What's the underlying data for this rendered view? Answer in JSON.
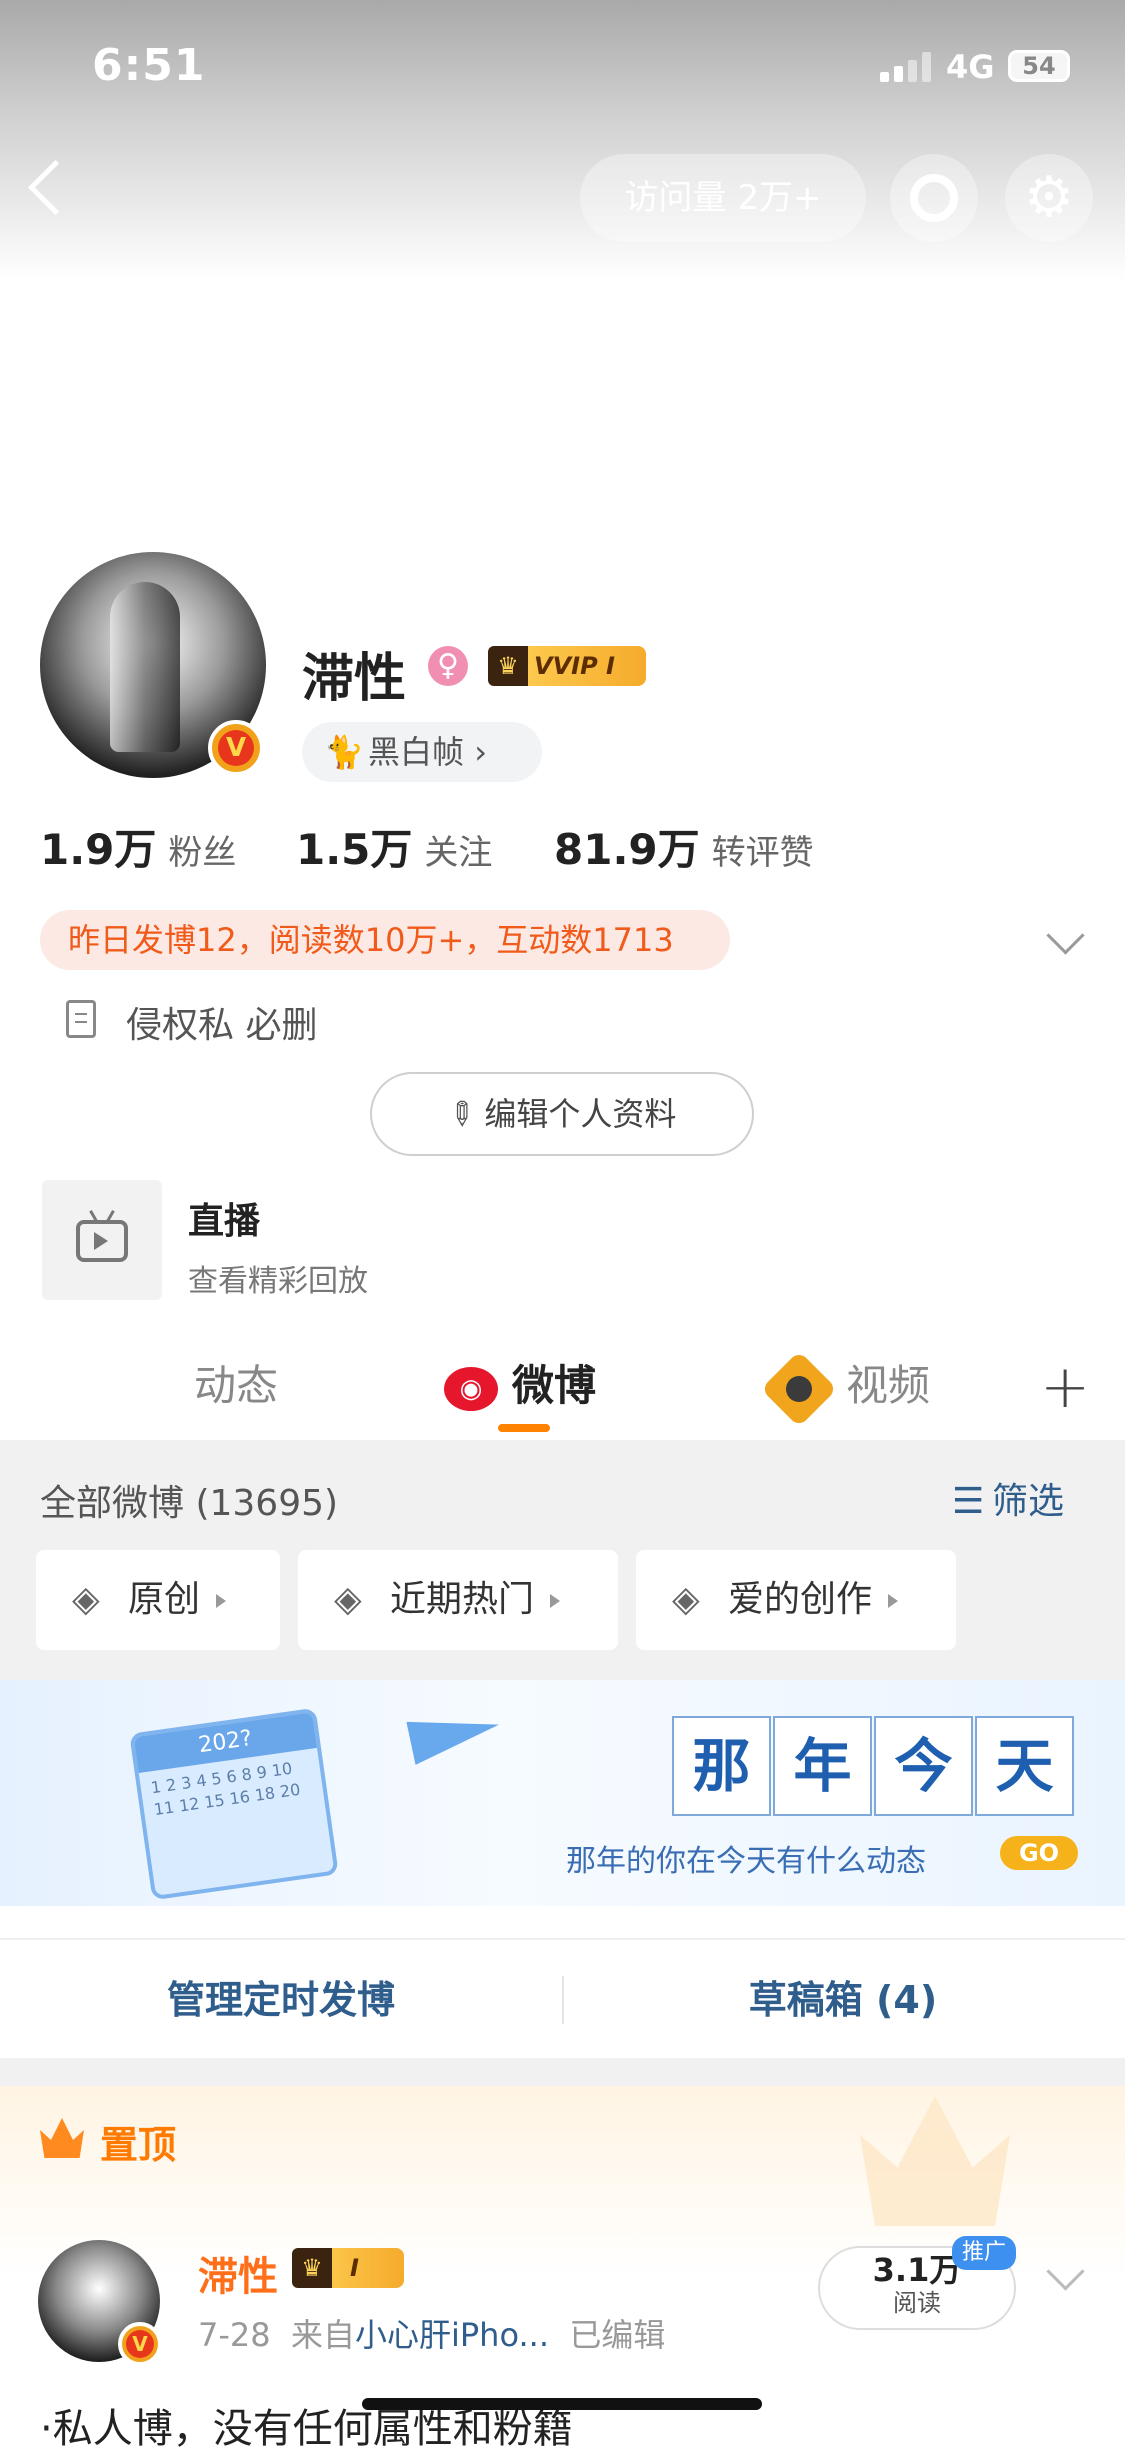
{
  "status_bar": {
    "time": "6:51",
    "network": "4G",
    "battery": "54"
  },
  "header": {
    "visits_label": "访问量 2万+"
  },
  "profile": {
    "name": "滞性",
    "gender_symbol": "♀",
    "vip_badge": "VVIP I",
    "verify_mark": "V",
    "tag_label": "黑白帧",
    "tag_chevron": "›",
    "stats": [
      {
        "value": "1.9万",
        "label": "粉丝"
      },
      {
        "value": "1.5万",
        "label": "关注"
      },
      {
        "value": "81.9万",
        "label": "转评赞"
      }
    ],
    "yesterday_stats": "昨日发博12，阅读数10万+，互动数1713",
    "bio": "侵权私 必删",
    "edit_button": "编辑个人资料"
  },
  "live": {
    "title": "直播",
    "subtitle": "查看精彩回放"
  },
  "tabs": [
    {
      "label": "动态",
      "active": false
    },
    {
      "label": "微博",
      "active": true
    },
    {
      "label": "视频",
      "active": false
    }
  ],
  "feed": {
    "all_count": "全部微博 (13695)",
    "filter_label": "筛选",
    "chips": [
      "原创",
      "近期热门",
      "爱的创作"
    ]
  },
  "banner": {
    "chars": [
      "那",
      "年",
      "今",
      "天"
    ],
    "subtitle": "那年的你在今天有什么动态",
    "go_label": "GO",
    "calendar_year": "202?",
    "calendar_days": "1 2 3 4 5 6 8 9 10 11 12 15 16 18 20"
  },
  "management": {
    "scheduled": "管理定时发博",
    "drafts": "草稿箱 (4)"
  },
  "pinned": {
    "label": "置顶",
    "author": "滞性",
    "vip_badge": "I",
    "date": "7-28",
    "source_prefix": "来自",
    "source": "小心肝iPho...",
    "edited": "已编辑",
    "reads_value": "3.1万",
    "reads_label": "阅读",
    "promo": "推广",
    "text": "·私人博，没有任何属性和粉籍"
  },
  "colors": {
    "accent": "#ff8200",
    "link": "#2f5d8c",
    "pinned": "#ff7a00"
  }
}
